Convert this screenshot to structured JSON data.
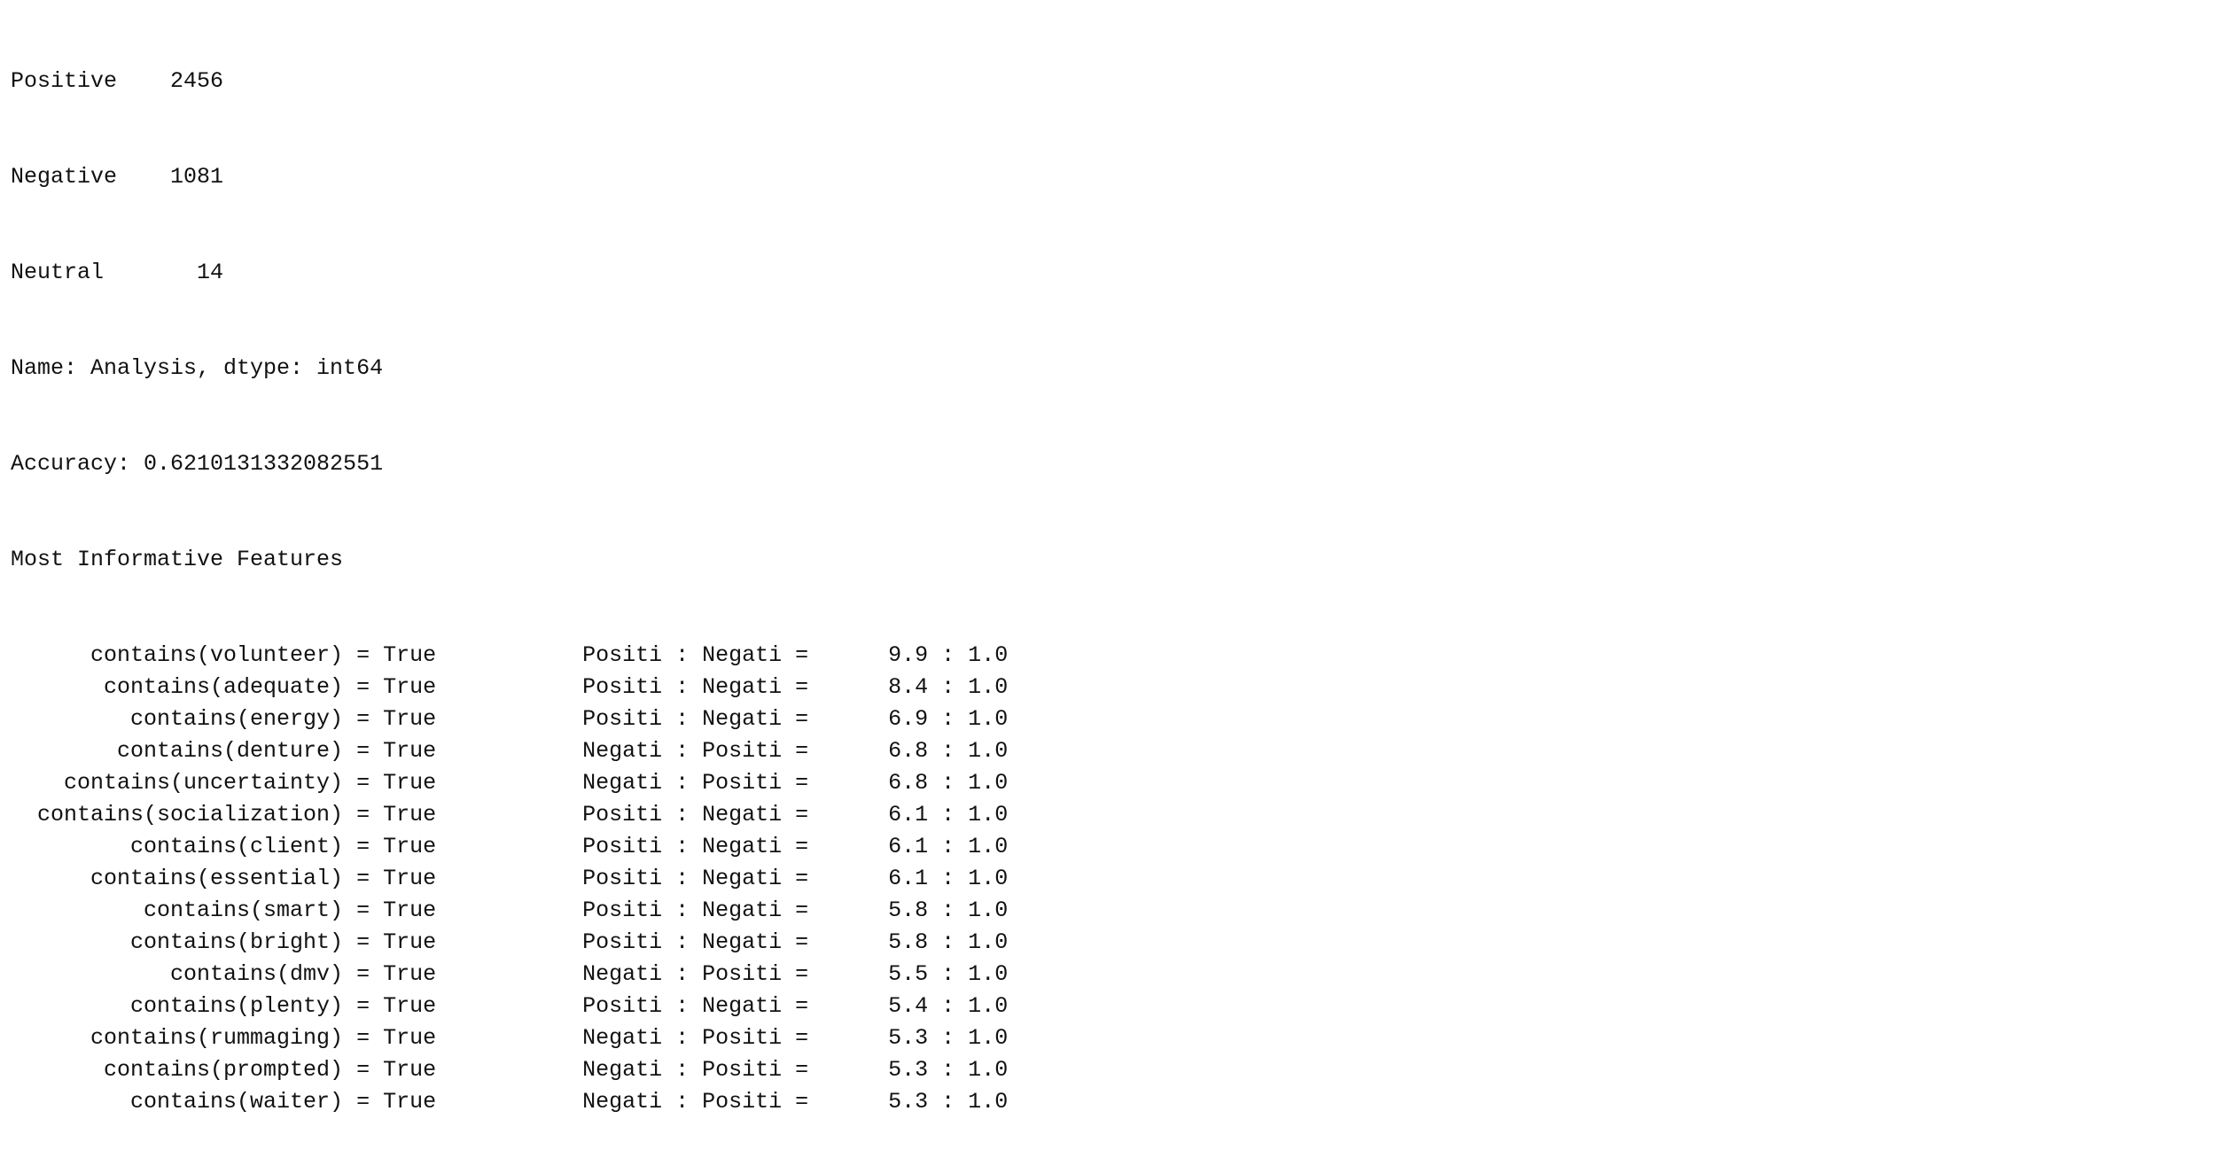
{
  "value_counts": [
    {
      "label": "Positive",
      "count": "2456"
    },
    {
      "label": "Negative",
      "count": "1081"
    },
    {
      "label": "Neutral",
      "count": "14"
    }
  ],
  "series_info": "Name: Analysis, dtype: int64",
  "accuracy": "Accuracy: 0.6210131332082551",
  "features_header": "Most Informative Features",
  "features": [
    {
      "feature": "contains(volunteer) = True",
      "labels": "Positi : Negati =",
      "ratio": "9.9 : 1.0"
    },
    {
      "feature": "contains(adequate) = True",
      "labels": "Positi : Negati =",
      "ratio": "8.4 : 1.0"
    },
    {
      "feature": "contains(energy) = True",
      "labels": "Positi : Negati =",
      "ratio": "6.9 : 1.0"
    },
    {
      "feature": "contains(denture) = True",
      "labels": "Negati : Positi =",
      "ratio": "6.8 : 1.0"
    },
    {
      "feature": "contains(uncertainty) = True",
      "labels": "Negati : Positi =",
      "ratio": "6.8 : 1.0"
    },
    {
      "feature": "contains(socialization) = True",
      "labels": "Positi : Negati =",
      "ratio": "6.1 : 1.0"
    },
    {
      "feature": "contains(client) = True",
      "labels": "Positi : Negati =",
      "ratio": "6.1 : 1.0"
    },
    {
      "feature": "contains(essential) = True",
      "labels": "Positi : Negati =",
      "ratio": "6.1 : 1.0"
    },
    {
      "feature": "contains(smart) = True",
      "labels": "Positi : Negati =",
      "ratio": "5.8 : 1.0"
    },
    {
      "feature": "contains(bright) = True",
      "labels": "Positi : Negati =",
      "ratio": "5.8 : 1.0"
    },
    {
      "feature": "contains(dmv) = True",
      "labels": "Negati : Positi =",
      "ratio": "5.5 : 1.0"
    },
    {
      "feature": "contains(plenty) = True",
      "labels": "Positi : Negati =",
      "ratio": "5.4 : 1.0"
    },
    {
      "feature": "contains(rummaging) = True",
      "labels": "Negati : Positi =",
      "ratio": "5.3 : 1.0"
    },
    {
      "feature": "contains(prompted) = True",
      "labels": "Negati : Positi =",
      "ratio": "5.3 : 1.0"
    },
    {
      "feature": "contains(waiter) = True",
      "labels": "Negati : Positi =",
      "ratio": "5.3 : 1.0"
    }
  ]
}
